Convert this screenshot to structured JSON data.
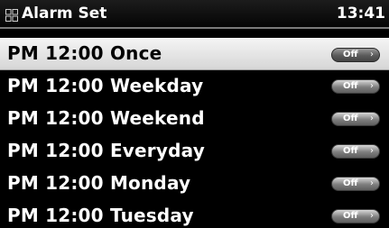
{
  "header": {
    "title": "Alarm Set",
    "time": "13:41",
    "icon": "alarm-grid-icon"
  },
  "alarms": [
    {
      "label": "PM 12:00 Once",
      "toggle": "Off",
      "selected": true
    },
    {
      "label": "PM 12:00 Weekday",
      "toggle": "Off",
      "selected": false
    },
    {
      "label": "PM 12:00 Weekend",
      "toggle": "Off",
      "selected": false
    },
    {
      "label": "PM 12:00 Everyday",
      "toggle": "Off",
      "selected": false
    },
    {
      "label": "PM 12:00 Monday",
      "toggle": "Off",
      "selected": false
    },
    {
      "label": "PM 12:00 Tuesday",
      "toggle": "Off",
      "selected": false
    }
  ],
  "colors": {
    "background": "#000000",
    "text": "#ffffff",
    "selected_row": "#e6e6e6",
    "selected_text": "#000000",
    "toggle": "#7e7e7e"
  }
}
